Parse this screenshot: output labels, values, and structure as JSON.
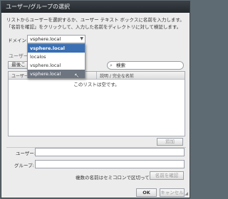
{
  "dialog": {
    "title": "ユーザー/グループの選択",
    "description": "リストからユーザーを選択するか、ユーザー テキスト ボックスに名前を入力します。「名前を確認」をクリックして、入力した名前をディレクトリに対して検証します。"
  },
  "domain": {
    "label": "ドメイン:",
    "selected": "vsphere.local",
    "options": [
      {
        "label": "vsphere.local"
      },
      {
        "label": "localos"
      },
      {
        "label": "vsphere.local"
      },
      {
        "label": "vsphere.local"
      }
    ]
  },
  "tabs": {
    "label": "ユーザー"
  },
  "toolbar": {
    "sort_label": "最後こ"
  },
  "search": {
    "value": "検索"
  },
  "grid": {
    "col_user": "ユーザー/グループ",
    "col_desc": "説明 / 完全な名前",
    "empty_text": "このリストは空です。"
  },
  "buttons": {
    "add": "追加",
    "check_names": "名前を確認",
    "ok": "OK",
    "cancel": "キャンセル"
  },
  "fields": {
    "user_label": "ユーザー:",
    "group_label": "グループ:",
    "user_value": "",
    "group_value": ""
  },
  "hint": "複数の名前はセミコロンで区切ってください"
}
